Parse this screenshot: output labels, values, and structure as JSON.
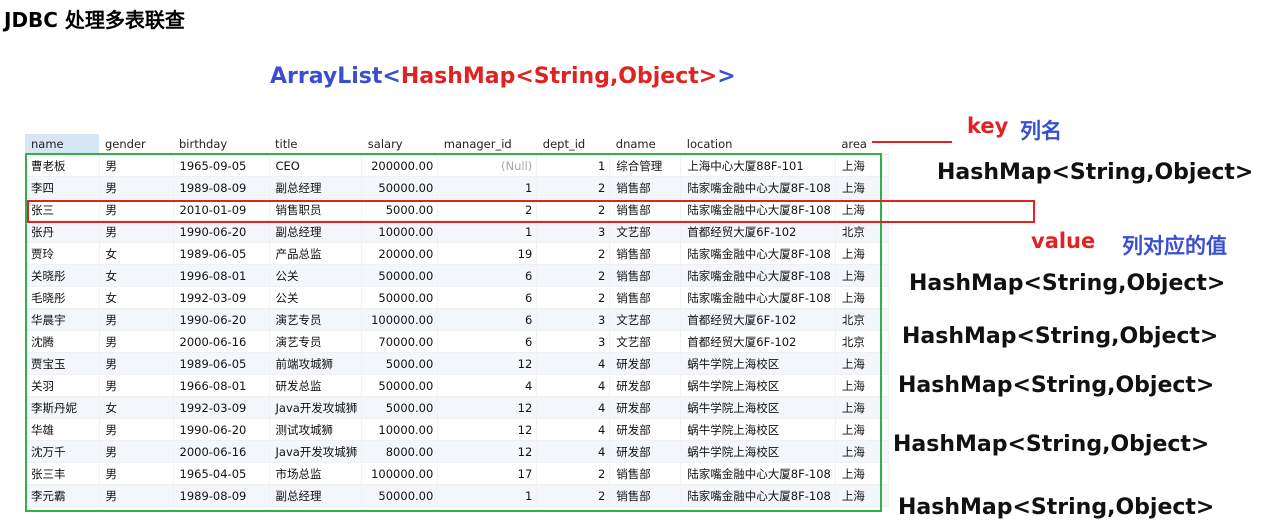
{
  "title": "JDBC 处理多表联查",
  "arraylist": {
    "p1": "ArrayList",
    "p2": "<",
    "p3": "HashMap<String,Object>",
    "p4": ">"
  },
  "table": {
    "columns": [
      "name",
      "gender",
      "birthday",
      "title",
      "salary",
      "manager_id",
      "dept_id",
      "dname",
      "location",
      "area"
    ],
    "rows": [
      [
        "曹老板",
        "男",
        "1965-09-05",
        "CEO",
        "200000.00",
        "(Null)",
        "1",
        "综合管理",
        "上海中心大厦88F-101",
        "上海"
      ],
      [
        "李四",
        "男",
        "1989-08-09",
        "副总经理",
        "50000.00",
        "1",
        "2",
        "销售部",
        "陆家嘴金融中心大厦8F-108",
        "上海"
      ],
      [
        "张三",
        "男",
        "2010-01-09",
        "销售职员",
        "5000.00",
        "2",
        "2",
        "销售部",
        "陆家嘴金融中心大厦8F-108",
        "上海"
      ],
      [
        "张丹",
        "男",
        "1990-06-20",
        "副总经理",
        "10000.00",
        "1",
        "3",
        "文艺部",
        "首都经贸大厦6F-102",
        "北京"
      ],
      [
        "贾玲",
        "女",
        "1989-06-05",
        "产品总监",
        "20000.00",
        "19",
        "2",
        "销售部",
        "陆家嘴金融中心大厦8F-108",
        "上海"
      ],
      [
        "关晓彤",
        "女",
        "1996-08-01",
        "公关",
        "50000.00",
        "6",
        "2",
        "销售部",
        "陆家嘴金融中心大厦8F-108",
        "上海"
      ],
      [
        "毛晓彤",
        "女",
        "1992-03-09",
        "公关",
        "50000.00",
        "6",
        "2",
        "销售部",
        "陆家嘴金融中心大厦8F-108",
        "上海"
      ],
      [
        "华晨宇",
        "男",
        "1990-06-20",
        "演艺专员",
        "100000.00",
        "6",
        "3",
        "文艺部",
        "首都经贸大厦6F-102",
        "北京"
      ],
      [
        "沈腾",
        "男",
        "2000-06-16",
        "演艺专员",
        "70000.00",
        "6",
        "3",
        "文艺部",
        "首都经贸大厦6F-102",
        "北京"
      ],
      [
        "贾宝玉",
        "男",
        "1989-06-05",
        "前端攻城狮",
        "5000.00",
        "12",
        "4",
        "研发部",
        "蜗牛学院上海校区",
        "上海"
      ],
      [
        "关羽",
        "男",
        "1966-08-01",
        "研发总监",
        "50000.00",
        "4",
        "4",
        "研发部",
        "蜗牛学院上海校区",
        "上海"
      ],
      [
        "李斯丹妮",
        "女",
        "1992-03-09",
        "Java开发攻城狮",
        "5000.00",
        "12",
        "4",
        "研发部",
        "蜗牛学院上海校区",
        "上海"
      ],
      [
        "华雄",
        "男",
        "1990-06-20",
        "测试攻城狮",
        "10000.00",
        "12",
        "4",
        "研发部",
        "蜗牛学院上海校区",
        "上海"
      ],
      [
        "沈万千",
        "男",
        "2000-06-16",
        "Java开发攻城狮",
        "8000.00",
        "12",
        "4",
        "研发部",
        "蜗牛学院上海校区",
        "上海"
      ],
      [
        "张三丰",
        "男",
        "1965-04-05",
        "市场总监",
        "100000.00",
        "17",
        "2",
        "销售部",
        "陆家嘴金融中心大厦8F-108",
        "上海"
      ],
      [
        "李元霸",
        "男",
        "1989-08-09",
        "副总经理",
        "50000.00",
        "1",
        "2",
        "销售部",
        "陆家嘴金融中心大厦8F-108",
        "上海"
      ]
    ]
  },
  "annotations": {
    "key": "key",
    "key_desc": "列名",
    "value": "value",
    "value_desc": "列对应的值",
    "hashmap": "HashMap<String,Object>"
  },
  "colors": {
    "red": "#e02222",
    "blue": "#3a4fd0",
    "green": "#2db34a",
    "header_highlight": "#d6e6f5"
  }
}
